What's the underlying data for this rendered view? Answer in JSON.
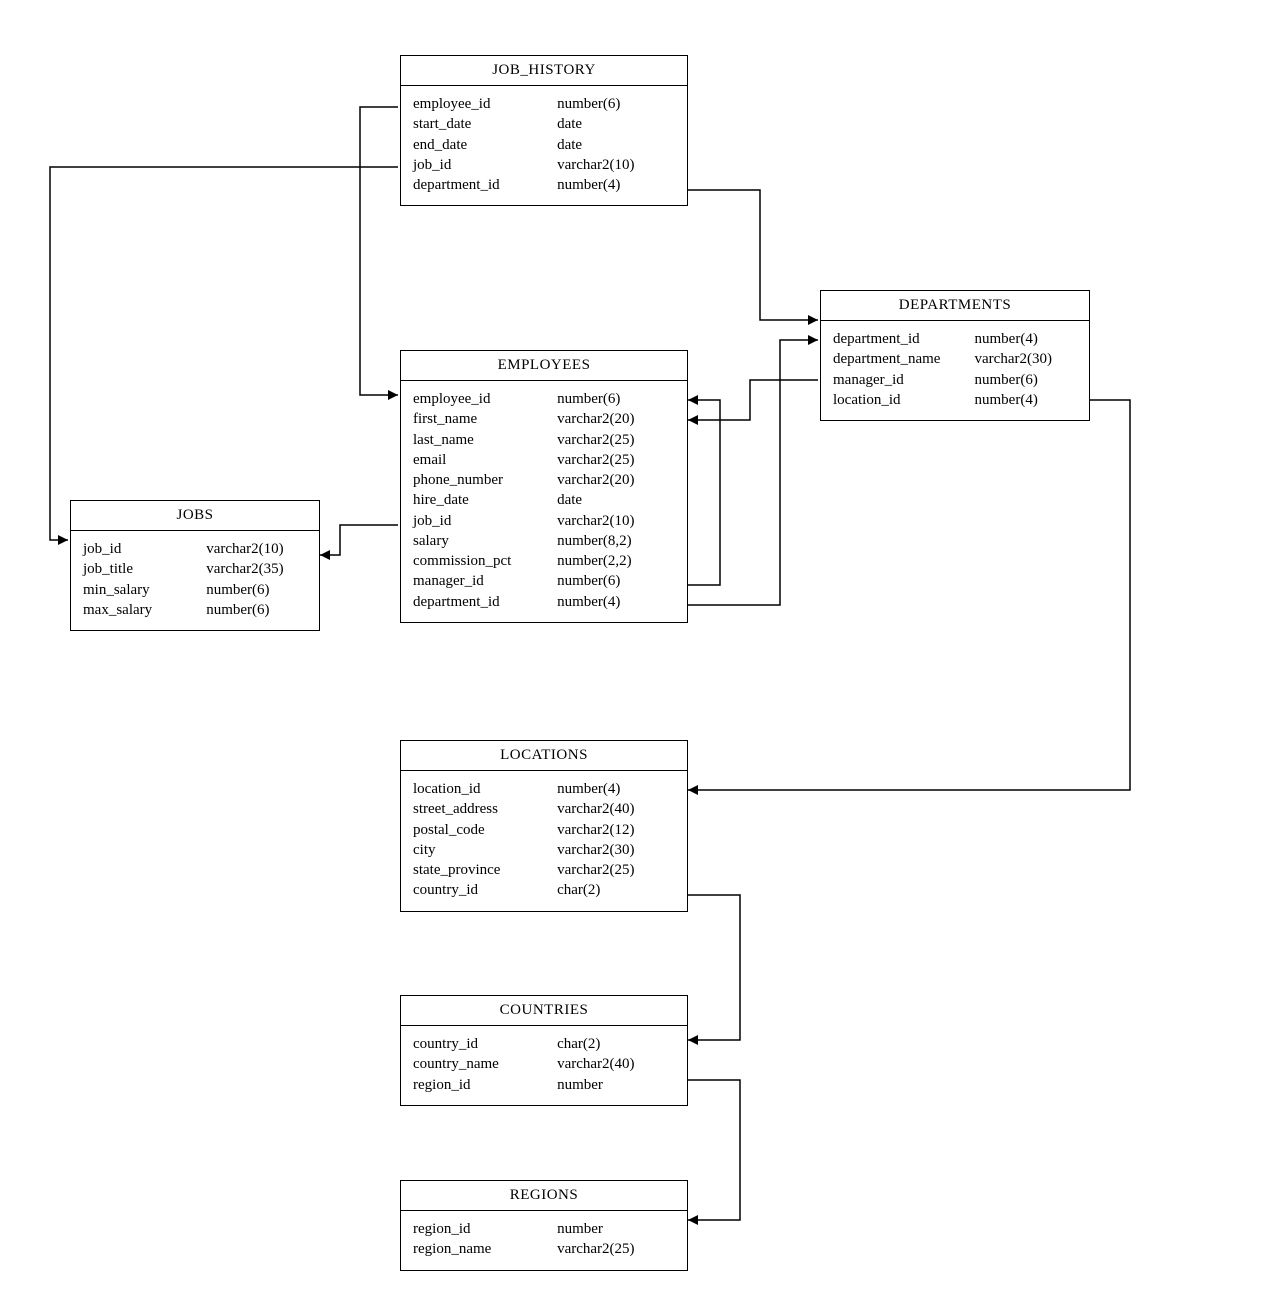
{
  "entities": {
    "job_history": {
      "title": "JOB_HISTORY",
      "columns": [
        {
          "name": "employee_id",
          "type": "number(6)"
        },
        {
          "name": "start_date",
          "type": "date"
        },
        {
          "name": "end_date",
          "type": "date"
        },
        {
          "name": "job_id",
          "type": "varchar2(10)"
        },
        {
          "name": "department_id",
          "type": "number(4)"
        }
      ]
    },
    "employees": {
      "title": "EMPLOYEES",
      "columns": [
        {
          "name": "employee_id",
          "type": "number(6)"
        },
        {
          "name": "first_name",
          "type": "varchar2(20)"
        },
        {
          "name": "last_name",
          "type": "varchar2(25)"
        },
        {
          "name": "email",
          "type": "varchar2(25)"
        },
        {
          "name": "phone_number",
          "type": "varchar2(20)"
        },
        {
          "name": "hire_date",
          "type": "date"
        },
        {
          "name": "job_id",
          "type": "varchar2(10)"
        },
        {
          "name": "salary",
          "type": "number(8,2)"
        },
        {
          "name": "commission_pct",
          "type": "number(2,2)"
        },
        {
          "name": "manager_id",
          "type": "number(6)"
        },
        {
          "name": "department_id",
          "type": "number(4)"
        }
      ]
    },
    "jobs": {
      "title": "JOBS",
      "columns": [
        {
          "name": "job_id",
          "type": "varchar2(10)"
        },
        {
          "name": "job_title",
          "type": "varchar2(35)"
        },
        {
          "name": "min_salary",
          "type": "number(6)"
        },
        {
          "name": "max_salary",
          "type": "number(6)"
        }
      ]
    },
    "departments": {
      "title": "DEPARTMENTS",
      "columns": [
        {
          "name": "department_id",
          "type": "number(4)"
        },
        {
          "name": "department_name",
          "type": "varchar2(30)"
        },
        {
          "name": "manager_id",
          "type": "number(6)"
        },
        {
          "name": "location_id",
          "type": "number(4)"
        }
      ]
    },
    "locations": {
      "title": "LOCATIONS",
      "columns": [
        {
          "name": "location_id",
          "type": "number(4)"
        },
        {
          "name": "street_address",
          "type": "varchar2(40)"
        },
        {
          "name": "postal_code",
          "type": "varchar2(12)"
        },
        {
          "name": "city",
          "type": "varchar2(30)"
        },
        {
          "name": "state_province",
          "type": "varchar2(25)"
        },
        {
          "name": "country_id",
          "type": "char(2)"
        }
      ]
    },
    "countries": {
      "title": "COUNTRIES",
      "columns": [
        {
          "name": "country_id",
          "type": "char(2)"
        },
        {
          "name": "country_name",
          "type": "varchar2(40)"
        },
        {
          "name": "region_id",
          "type": "number"
        }
      ]
    },
    "regions": {
      "title": "REGIONS",
      "columns": [
        {
          "name": "region_id",
          "type": "number"
        },
        {
          "name": "region_name",
          "type": "varchar2(25)"
        }
      ]
    }
  },
  "relationships": [
    {
      "from": "JOB_HISTORY.employee_id",
      "to": "EMPLOYEES.employee_id"
    },
    {
      "from": "JOB_HISTORY.job_id",
      "to": "JOBS.job_id"
    },
    {
      "from": "JOB_HISTORY.department_id",
      "to": "DEPARTMENTS.department_id"
    },
    {
      "from": "EMPLOYEES.job_id",
      "to": "JOBS.job_id"
    },
    {
      "from": "EMPLOYEES.manager_id",
      "to": "EMPLOYEES.employee_id"
    },
    {
      "from": "EMPLOYEES.department_id",
      "to": "DEPARTMENTS.department_id"
    },
    {
      "from": "DEPARTMENTS.manager_id",
      "to": "EMPLOYEES.employee_id"
    },
    {
      "from": "DEPARTMENTS.location_id",
      "to": "LOCATIONS.location_id"
    },
    {
      "from": "LOCATIONS.country_id",
      "to": "COUNTRIES.country_id"
    },
    {
      "from": "COUNTRIES.region_id",
      "to": "REGIONS.region_id"
    }
  ]
}
